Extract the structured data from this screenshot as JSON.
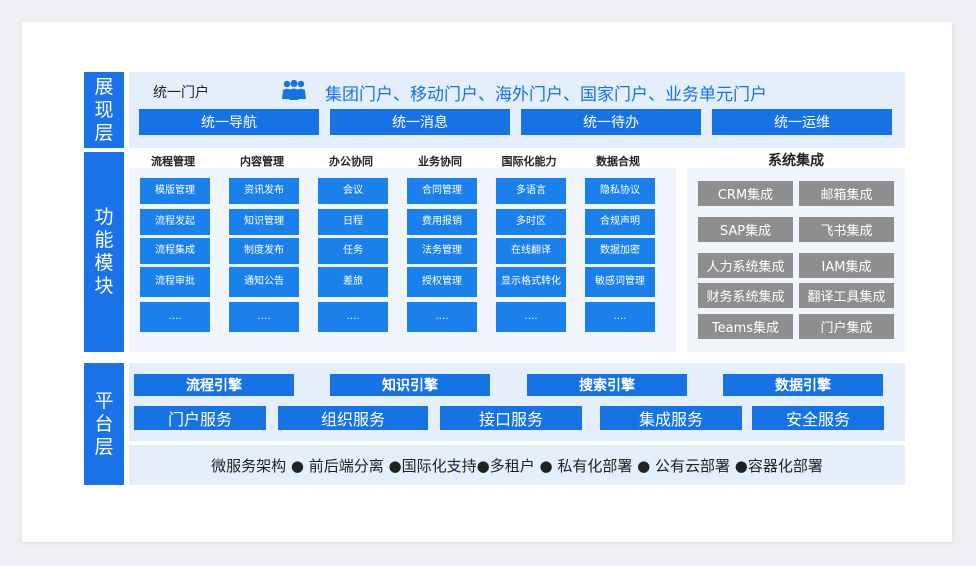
{
  "layers": {
    "display": {
      "label_chars": [
        "展",
        "现",
        "层"
      ]
    },
    "function": {
      "label_chars": [
        "功",
        "能",
        "模",
        "块"
      ]
    },
    "platform": {
      "label_chars": [
        "平",
        "台",
        "层"
      ]
    }
  },
  "display": {
    "portal_label": "统一门户",
    "portals_text": "集团门户、移动门户、海外门户、国家门户、业务单元门户",
    "buttons": [
      "统一导航",
      "统一消息",
      "统一待办",
      "统一运维"
    ]
  },
  "function": {
    "columns": [
      {
        "title": "流程管理",
        "items": [
          "模版管理",
          "流程发起",
          "流程集成",
          "流程审批",
          "…."
        ]
      },
      {
        "title": "内容管理",
        "items": [
          "资讯发布",
          "知识管理",
          "制度发布",
          "通知公告",
          "…."
        ]
      },
      {
        "title": "办公协同",
        "items": [
          "会议",
          "日程",
          "任务",
          "差旅",
          "…."
        ]
      },
      {
        "title": "业务协同",
        "items": [
          "合同管理",
          "费用报销",
          "法务管理",
          "授权管理",
          "…."
        ]
      },
      {
        "title": "国际化能力",
        "items": [
          "多语言",
          "多时区",
          "在线翻译",
          "显示格式转化",
          "…."
        ]
      },
      {
        "title": "数据合规",
        "items": [
          "隐私协议",
          "合规声明",
          "数据加密",
          "敏感词管理",
          "…."
        ]
      }
    ],
    "system_integration": {
      "title": "系统集成",
      "items": [
        "CRM集成",
        "邮箱集成",
        "SAP集成",
        "飞书集成",
        "人力系统集成",
        "IAM集成",
        "财务系统集成",
        "翻译工具集成",
        "Teams集成",
        "门户集成"
      ]
    }
  },
  "platform": {
    "engines": [
      "流程引擎",
      "知识引擎",
      "搜索引擎",
      "数据引擎"
    ],
    "services": [
      "门户服务",
      "组织服务",
      "接口服务",
      "集成服务",
      "安全服务"
    ],
    "architecture": "微服务架构 ● 前后端分离 ●国际化支持●多租户 ● 私有化部署 ● 公有云部署 ●容器化部署"
  },
  "colors": {
    "primary": "#1673e6",
    "band": "#e4effb",
    "grey": "#8e8e8e"
  }
}
